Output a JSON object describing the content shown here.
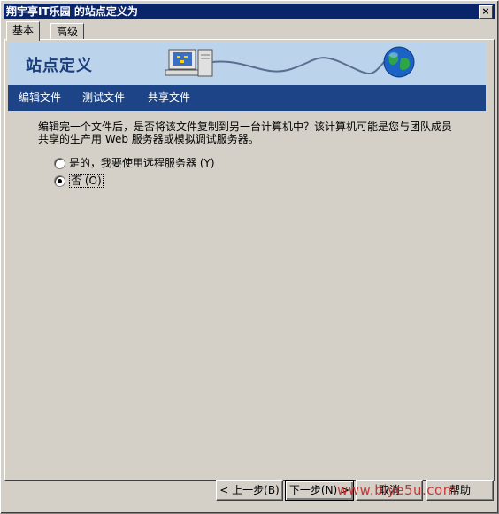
{
  "window": {
    "title": "翔宇亭IT乐园 的站点定义为",
    "close_symbol": "×"
  },
  "tabs": [
    {
      "label": "基本",
      "active": true
    },
    {
      "label": "高级",
      "active": false
    }
  ],
  "banner": {
    "title": "站点定义"
  },
  "steps": [
    "编辑文件",
    "测试文件",
    "共享文件"
  ],
  "content": {
    "description": "编辑完一个文件后，是否将该文件复制到另一台计算机中？该计算机可能是您与团队成员共享的生产用 Web 服务器或模拟调试服务器。",
    "options": [
      {
        "label": "是的，我要使用远程服务器 (Y)",
        "checked": false
      },
      {
        "label": "否 (O)",
        "checked": true
      }
    ]
  },
  "buttons": {
    "back": "< 上一步(B)",
    "next": "下一步(N) >",
    "cancel": "取消",
    "help": "帮助"
  },
  "watermark": "www.biye5u.com",
  "colors": {
    "titlebar": "#0a246a",
    "banner": "#bcd3ec",
    "stepbar": "#1c4486",
    "window": "#d4d0c8"
  }
}
